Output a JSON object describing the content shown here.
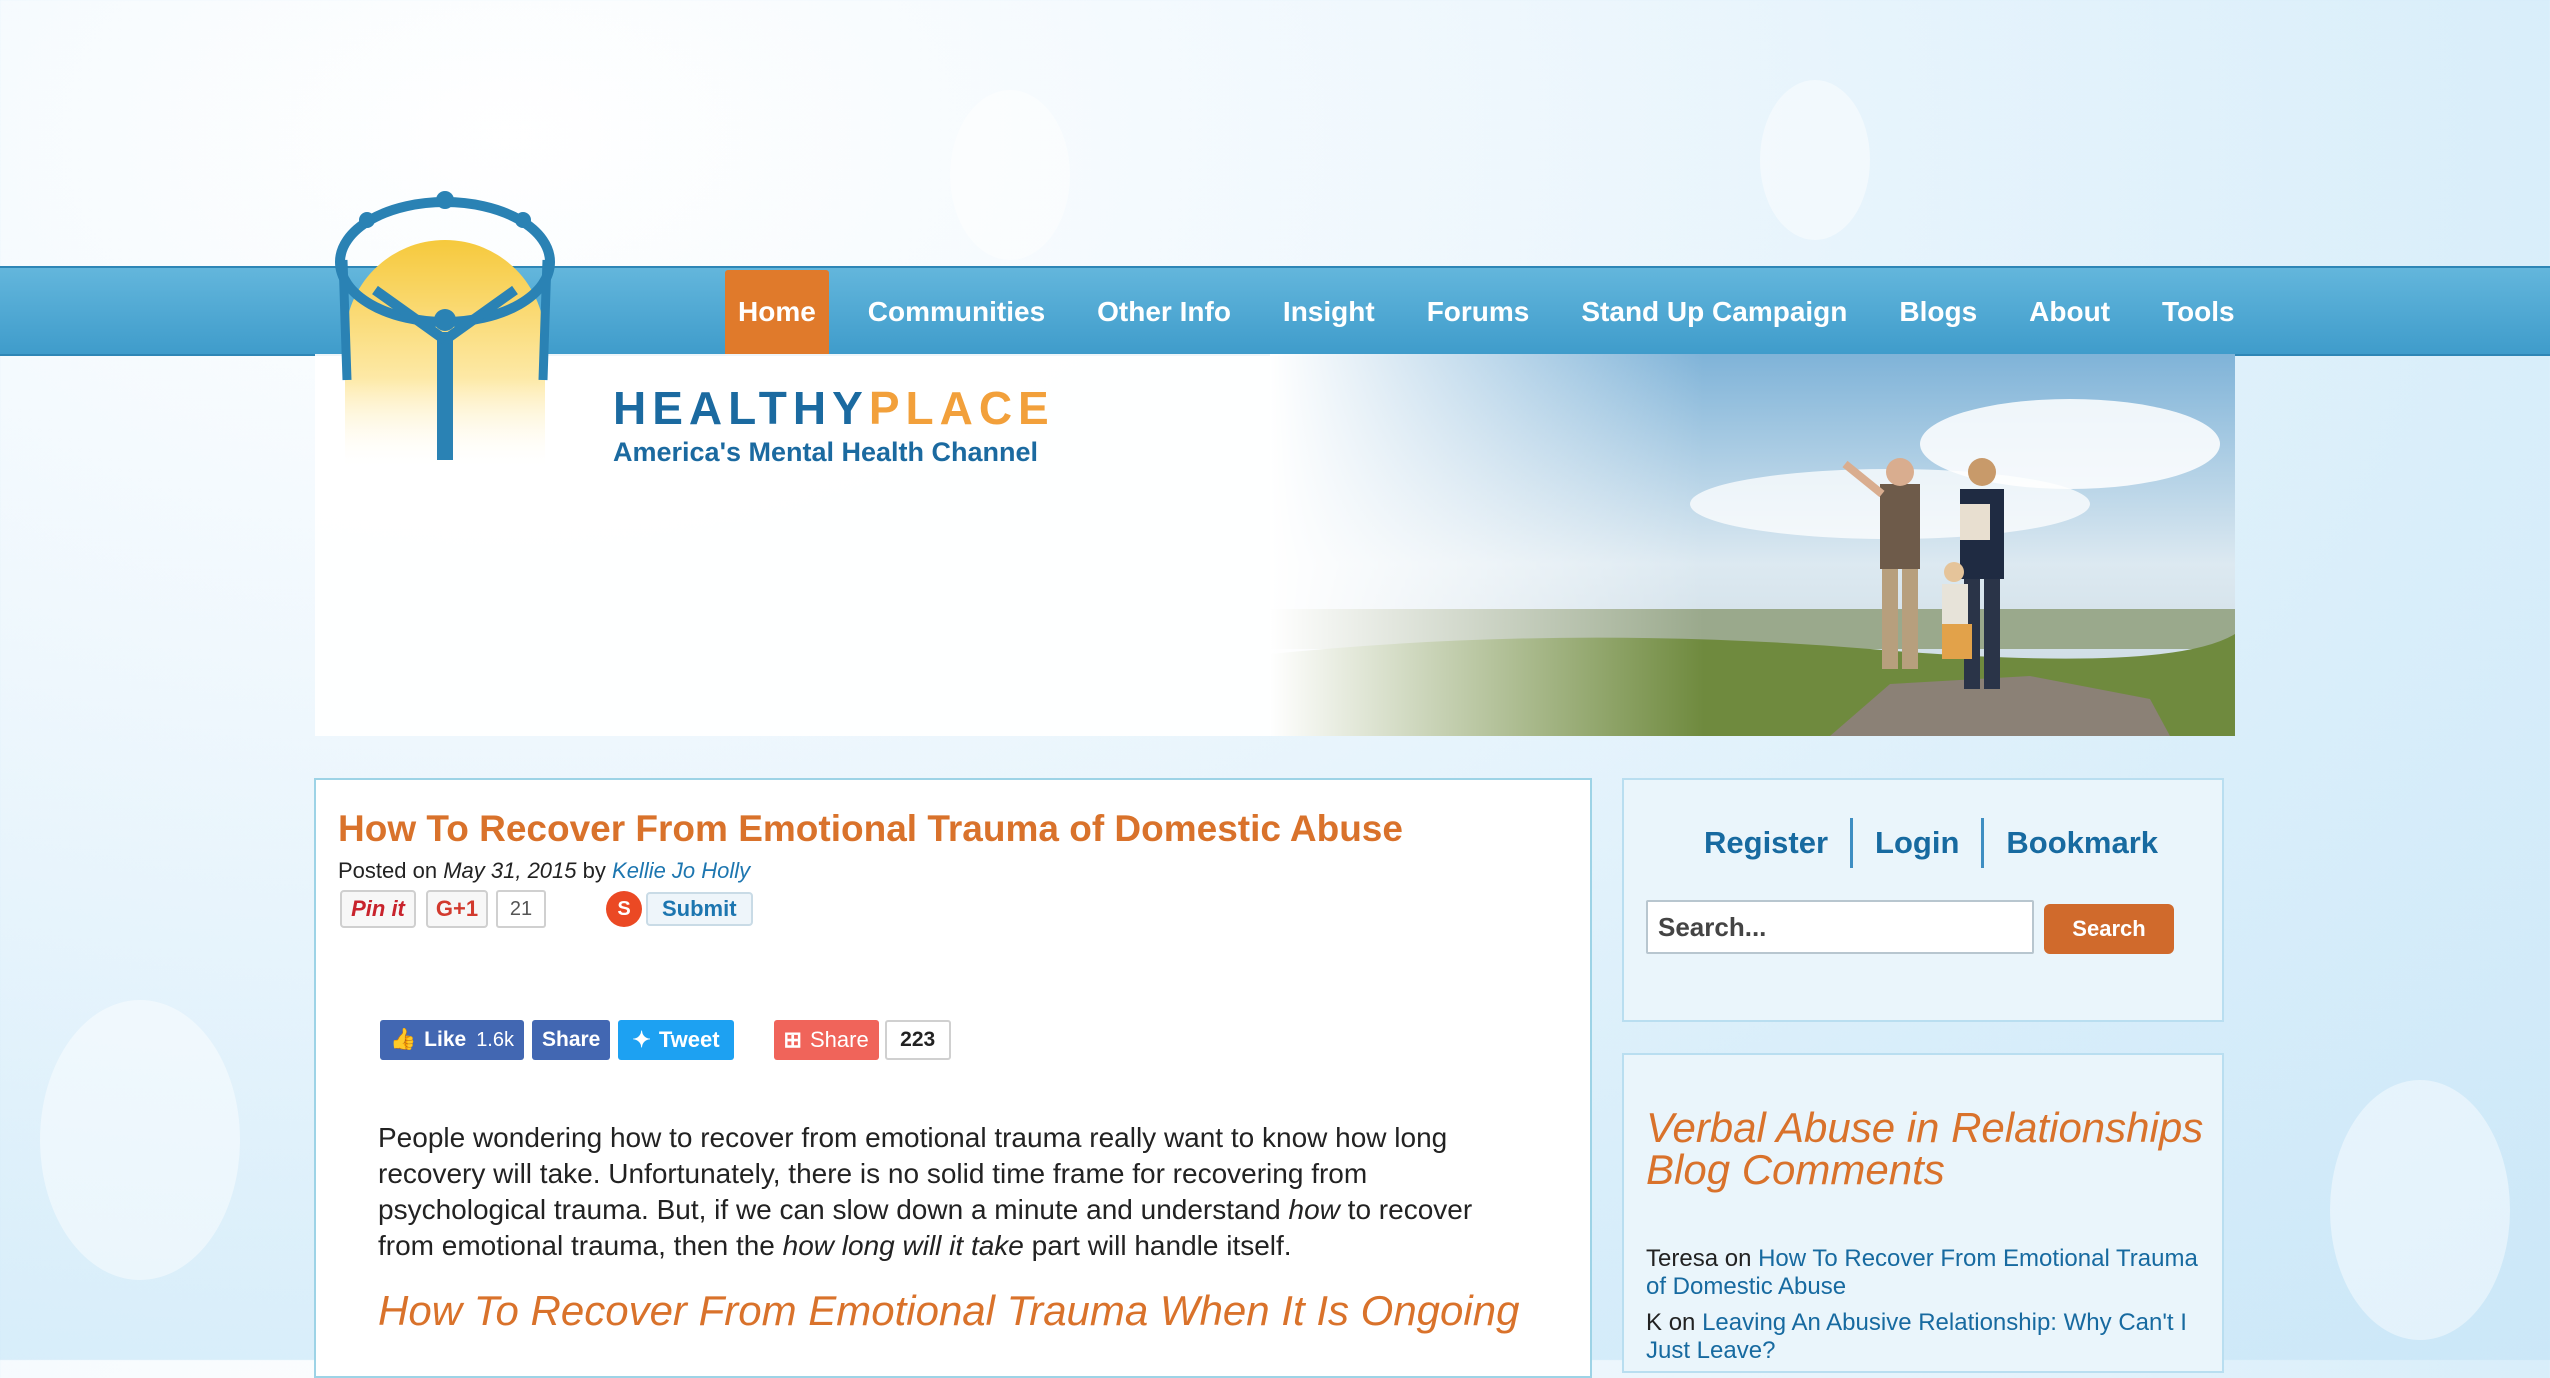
{
  "nav": {
    "items": [
      "Home",
      "Communities",
      "Other Info",
      "Insight",
      "Forums",
      "Stand Up Campaign",
      "Blogs",
      "About",
      "Tools"
    ],
    "active": "Home"
  },
  "brand": {
    "name_part1": "HEALTHY",
    "name_part2": "PLACE",
    "tagline": "America's Mental Health Channel",
    "colors": {
      "blue": "#1b6aa0",
      "orange": "#f2a03b"
    }
  },
  "article": {
    "title": "How To Recover From Emotional Trauma of Domestic Abuse",
    "posted_prefix": "Posted on",
    "date": "May 31, 2015",
    "by": "by",
    "author": "Kellie Jo Holly",
    "social_top": {
      "pinit": "Pin it",
      "gplus": "G+1",
      "gplus_count": "21",
      "stumble_icon": "stumbleupon-icon",
      "submit": "Submit"
    },
    "social_bottom": {
      "fb_like": "Like",
      "fb_like_count": "1.6k",
      "fb_share": "Share",
      "tweet": "Tweet",
      "share": "Share",
      "share_count": "223"
    },
    "body": {
      "p1_a": "People wondering how to recover from emotional trauma really want to know how long recovery will take. Unfortunately, there is no solid time frame for recovering from psychological trauma. But, if we can slow down a minute and understand ",
      "p1_b": "how",
      "p1_c": " to recover from emotional trauma, then the ",
      "p1_d": "how long will it take",
      "p1_e": " part will handle itself."
    },
    "subheading": "How To Recover From Emotional Trauma When It Is Ongoing"
  },
  "sidebar": {
    "auth": {
      "register": "Register",
      "login": "Login",
      "bookmark": "Bookmark"
    },
    "search": {
      "placeholder": "Search...",
      "button": "Search"
    },
    "comments_title": "Verbal Abuse in Relationships Blog Comments",
    "comments": [
      {
        "author": "Teresa",
        "on": "on",
        "link": "How To Recover From Emotional Trauma of Domestic Abuse"
      },
      {
        "author": "K",
        "on": "on",
        "link": "Leaving An Abusive Relationship: Why Can't I Just Leave?"
      }
    ]
  },
  "colors": {
    "nav_blue": "#4aa6d3",
    "accent_orange": "#d9722b",
    "link_blue": "#176aa0"
  }
}
